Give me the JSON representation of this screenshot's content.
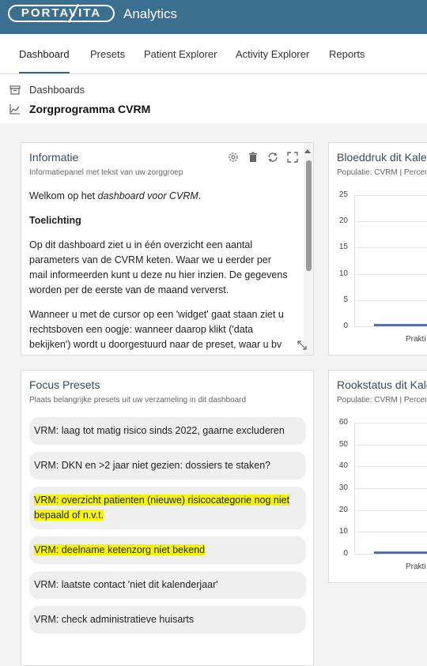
{
  "header": {
    "logo_text": "PORTAVITA",
    "app_name": "Analytics"
  },
  "nav": {
    "tabs": [
      {
        "label": "Dashboard"
      },
      {
        "label": "Presets"
      },
      {
        "label": "Patient Explorer"
      },
      {
        "label": "Activity Explorer"
      },
      {
        "label": "Reports"
      }
    ],
    "active_tab": "Dashboard"
  },
  "breadcrumb": {
    "parent": "Dashboards",
    "current": "Zorgprogramma CVRM"
  },
  "info_panel": {
    "title": "Informatie",
    "subtitle": "Informatiepanel met tekst van uw zorggroep",
    "welcome_prefix": "Welkom op het ",
    "welcome_em": "dashboard voor CVRM",
    "welcome_suffix": ".",
    "heading": "Toelichting",
    "para1": "Op dit dashboard ziet u in één overzicht een aantal parameters van de CVRM keten. Waar we u eerder per mail informeerden kunt u deze nu hier inzien. De gegevens worden per de eerste van de maand ververst.",
    "para2": "Wanneer u met de cursor op een 'widget' gaat staan ziet u rechtsboven een oogje: wanneer daarop klikt ('data bekijken') wordt u doorgestuurd naar de preset, waar u bv"
  },
  "chart1": {
    "title": "Bloeddruk dit Kale",
    "subtitle": "Populatie: CVRM | Percen",
    "y_ticks": [
      "25",
      "20",
      "15",
      "10",
      "5",
      "0"
    ],
    "x_label": "Prakti"
  },
  "focus_panel": {
    "title": "Focus Presets",
    "subtitle": "Plaats belangrijke presets uit uw verzameling in dit dashboard",
    "presets": [
      {
        "label": "VRM: laag tot matig risico sinds 2022, gaarne excluderen"
      },
      {
        "label": "VRM: DKN en >2 jaar niet gezien: dossiers te staken?"
      },
      {
        "label_line1": "VRM: overzicht patienten (nieuwe) risicocategorie nog niet",
        "label_line2": "bepaald of n.v.t."
      },
      {
        "label": "VRM: deelname ketenzorg niet bekend"
      },
      {
        "label": "VRM: laatste contact 'niet dit kalenderjaar'"
      },
      {
        "label": "VRM: check administratieve huisarts"
      }
    ]
  },
  "chart2": {
    "title": "Rookstatus dit Kale",
    "subtitle": "Populatie: CVRM | Percen",
    "y_ticks": [
      "60",
      "50",
      "40",
      "30",
      "20",
      "10",
      "0"
    ],
    "x_label": "Prakti"
  },
  "colors": {
    "topbar": "#3a6f8f",
    "highlight": "#f6f600",
    "series": "#5b6fa6"
  }
}
